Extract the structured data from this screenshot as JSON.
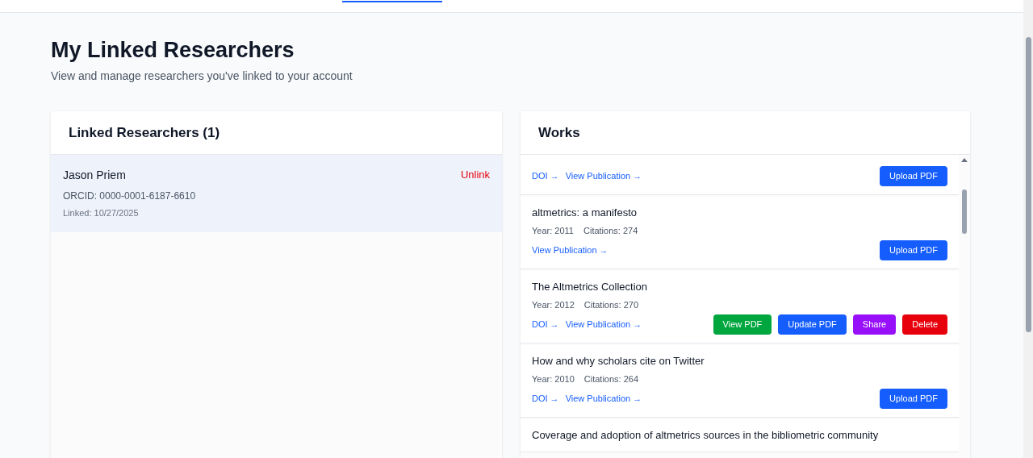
{
  "page": {
    "title": "My Linked Researchers",
    "subtitle": "View and manage researchers you've linked to your account"
  },
  "researchers_panel": {
    "title": "Linked Researchers (1)",
    "items": [
      {
        "name": "Jason Priem",
        "orcid": "ORCID: 0000-0001-6187-6610",
        "linked": "Linked: 10/27/2025",
        "action": "Unlink",
        "selected": true
      }
    ]
  },
  "works_panel": {
    "title": "Works",
    "items": [
      {
        "links": [
          "DOI →",
          "View Publication →"
        ],
        "buttons": [
          {
            "label": "Upload PDF",
            "kind": "upload"
          }
        ]
      },
      {
        "title": "altmetrics: a manifesto",
        "year": "Year: 2011",
        "citations": "Citations: 274",
        "links": [
          "View Publication →"
        ],
        "buttons": [
          {
            "label": "Upload PDF",
            "kind": "upload"
          }
        ]
      },
      {
        "title": "The Altmetrics Collection",
        "year": "Year: 2012",
        "citations": "Citations: 270",
        "links": [
          "DOI →",
          "View Publication →"
        ],
        "buttons": [
          {
            "label": "View PDF",
            "kind": "view"
          },
          {
            "label": "Update PDF",
            "kind": "update"
          },
          {
            "label": "Share",
            "kind": "share"
          },
          {
            "label": "Delete",
            "kind": "delete"
          }
        ]
      },
      {
        "title": "How and why scholars cite on Twitter",
        "year": "Year: 2010",
        "citations": "Citations: 264",
        "links": [
          "DOI →",
          "View Publication →"
        ],
        "buttons": [
          {
            "label": "Upload PDF",
            "kind": "upload"
          }
        ]
      },
      {
        "title": "Coverage and adoption of altmetrics sources in the bibliometric community"
      }
    ]
  }
}
